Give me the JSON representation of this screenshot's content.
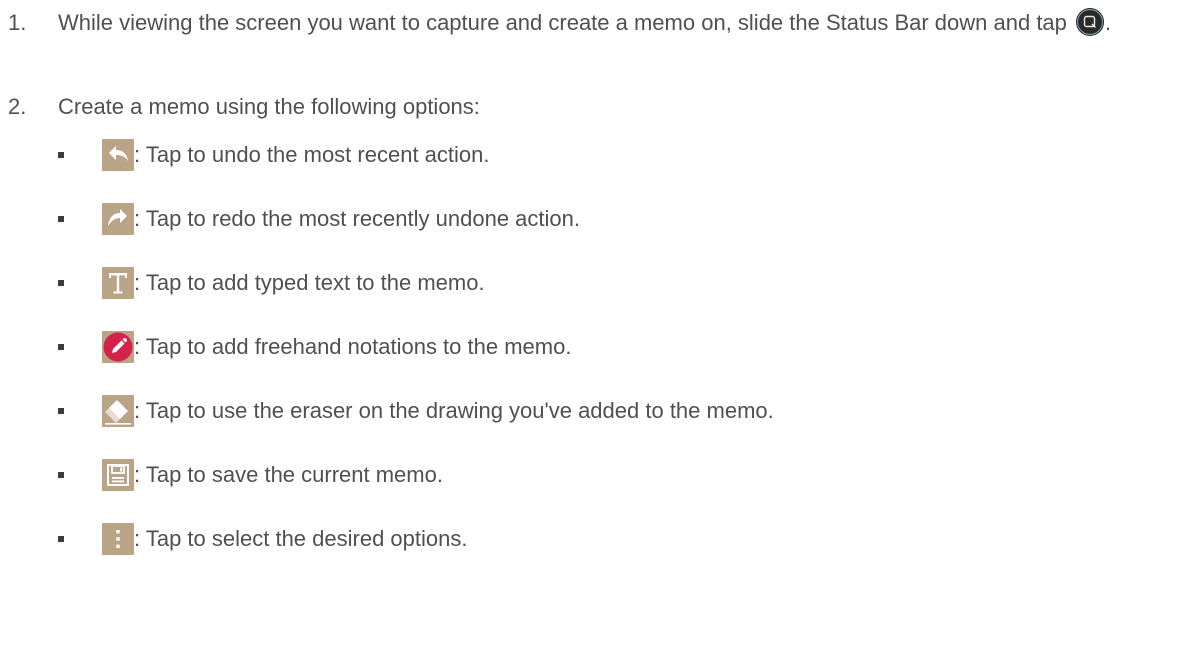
{
  "steps": [
    {
      "number": "1.",
      "text_before_icon": "While viewing the screen you want to capture and create a memo on, slide the Status Bar down and tap ",
      "text_after_icon": ".",
      "icon": "qmemo-circle-icon"
    },
    {
      "number": "2.",
      "text": "Create a memo using the following options:"
    }
  ],
  "options": [
    {
      "icon": "undo-arrow-icon",
      "text": ": Tap to undo the most recent action."
    },
    {
      "icon": "redo-arrow-icon",
      "text": ": Tap to redo the most recently undone action."
    },
    {
      "icon": "text-t-icon",
      "text": ": Tap to add typed text to the memo."
    },
    {
      "icon": "pen-red-circle-icon",
      "text": ": Tap to add freehand notations to the memo."
    },
    {
      "icon": "eraser-icon",
      "text": ": Tap to use the eraser on the drawing you've added to the memo."
    },
    {
      "icon": "save-floppy-icon",
      "text": ": Tap to save the current memo."
    },
    {
      "icon": "more-options-vertical-dots-icon",
      "text": ": Tap to select the desired options."
    }
  ],
  "colors": {
    "text": "#505050",
    "icon_tan": "#b9a487",
    "pen_red": "#d3234a"
  }
}
